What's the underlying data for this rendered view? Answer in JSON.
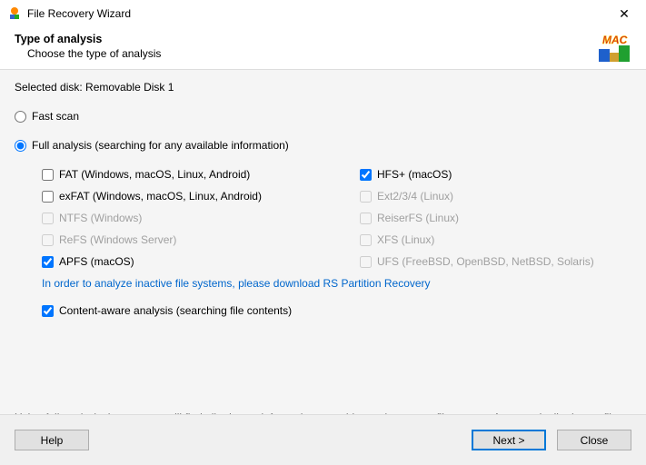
{
  "window": {
    "title": "File Recovery Wizard",
    "close_label": "✕"
  },
  "header": {
    "title": "Type of analysis",
    "subtitle": "Choose the type of analysis",
    "logo_text": "MAC"
  },
  "selected_disk": "Selected disk: Removable Disk 1",
  "scan_options": {
    "fast": {
      "label": "Fast scan",
      "checked": false
    },
    "full": {
      "label": "Full analysis (searching for any available information)",
      "checked": true
    }
  },
  "filesystems": {
    "col1": [
      {
        "label": "FAT (Windows, macOS, Linux, Android)",
        "checked": false,
        "enabled": true
      },
      {
        "label": "exFAT (Windows, macOS, Linux, Android)",
        "checked": false,
        "enabled": true
      },
      {
        "label": "NTFS (Windows)",
        "checked": false,
        "enabled": false
      },
      {
        "label": "ReFS (Windows Server)",
        "checked": false,
        "enabled": false
      },
      {
        "label": "APFS (macOS)",
        "checked": true,
        "enabled": true
      }
    ],
    "col2": [
      {
        "label": "HFS+ (macOS)",
        "checked": true,
        "enabled": true
      },
      {
        "label": "Ext2/3/4 (Linux)",
        "checked": false,
        "enabled": false
      },
      {
        "label": "ReiserFS (Linux)",
        "checked": false,
        "enabled": false
      },
      {
        "label": "XFS (Linux)",
        "checked": false,
        "enabled": false
      },
      {
        "label": "UFS (FreeBSD, OpenBSD, NetBSD, Solaris)",
        "checked": false,
        "enabled": false
      }
    ]
  },
  "link_text": "In order to analyze inactive file systems, please download RS Partition Recovery",
  "content_aware": {
    "label": "Content-aware analysis (searching file contents)",
    "checked": true
  },
  "description": "Using full analysis the program will find all relevant information on a drive and restore a file system. As a result all relevant files will be restored.",
  "buttons": {
    "help": "Help",
    "next": "Next >",
    "close": "Close"
  }
}
